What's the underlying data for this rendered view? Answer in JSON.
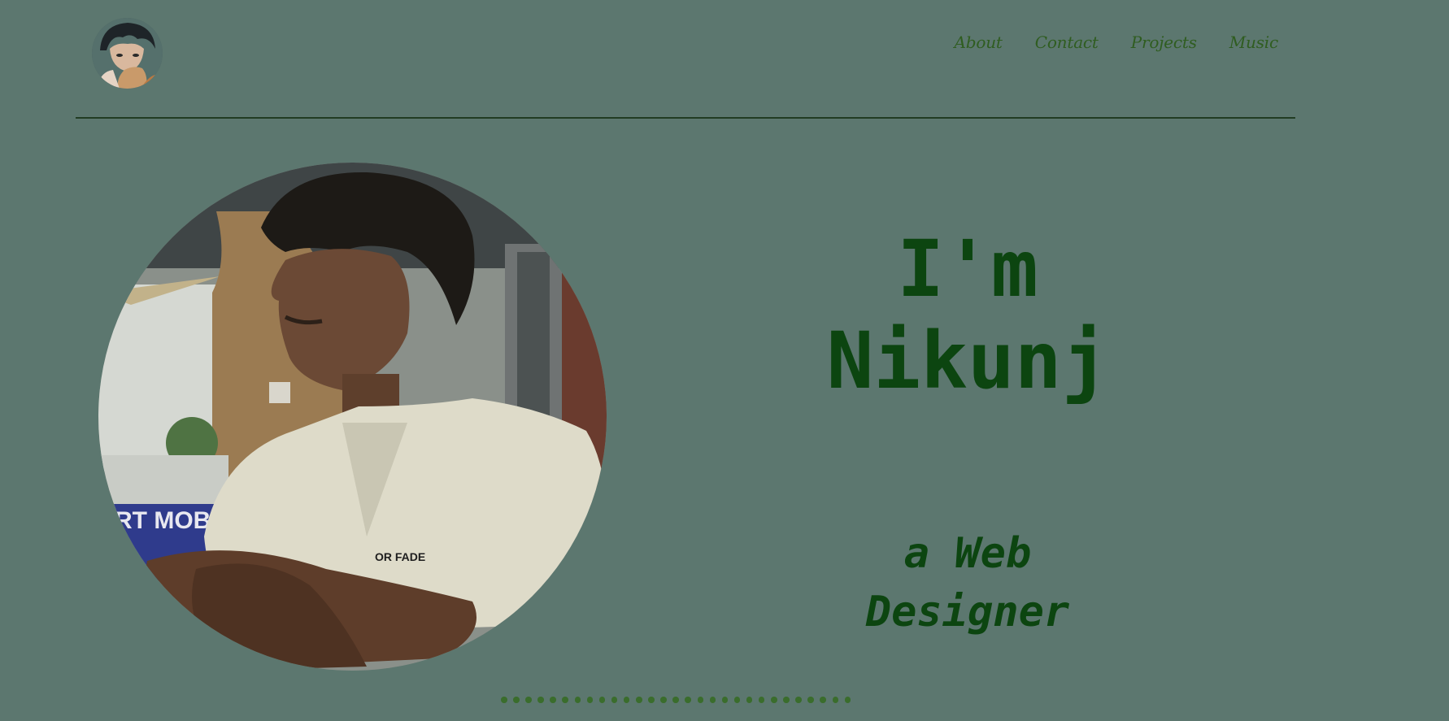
{
  "nav": {
    "items": [
      {
        "label": "About"
      },
      {
        "label": "Contact"
      },
      {
        "label": "Projects"
      },
      {
        "label": "Music"
      }
    ]
  },
  "hero": {
    "greeting": "I'm",
    "name": "Nikunj",
    "tagline_line1": "a Web",
    "tagline_line2": "Designer"
  },
  "photo": {
    "sign_text": "RT MOBI",
    "shirt_text": "OR FADE"
  },
  "carousel": {
    "dot_count": 29
  },
  "colors": {
    "background": "#5c776f",
    "heading": "#0c4510",
    "nav_text": "#2f5d20",
    "divider": "#213c23"
  }
}
